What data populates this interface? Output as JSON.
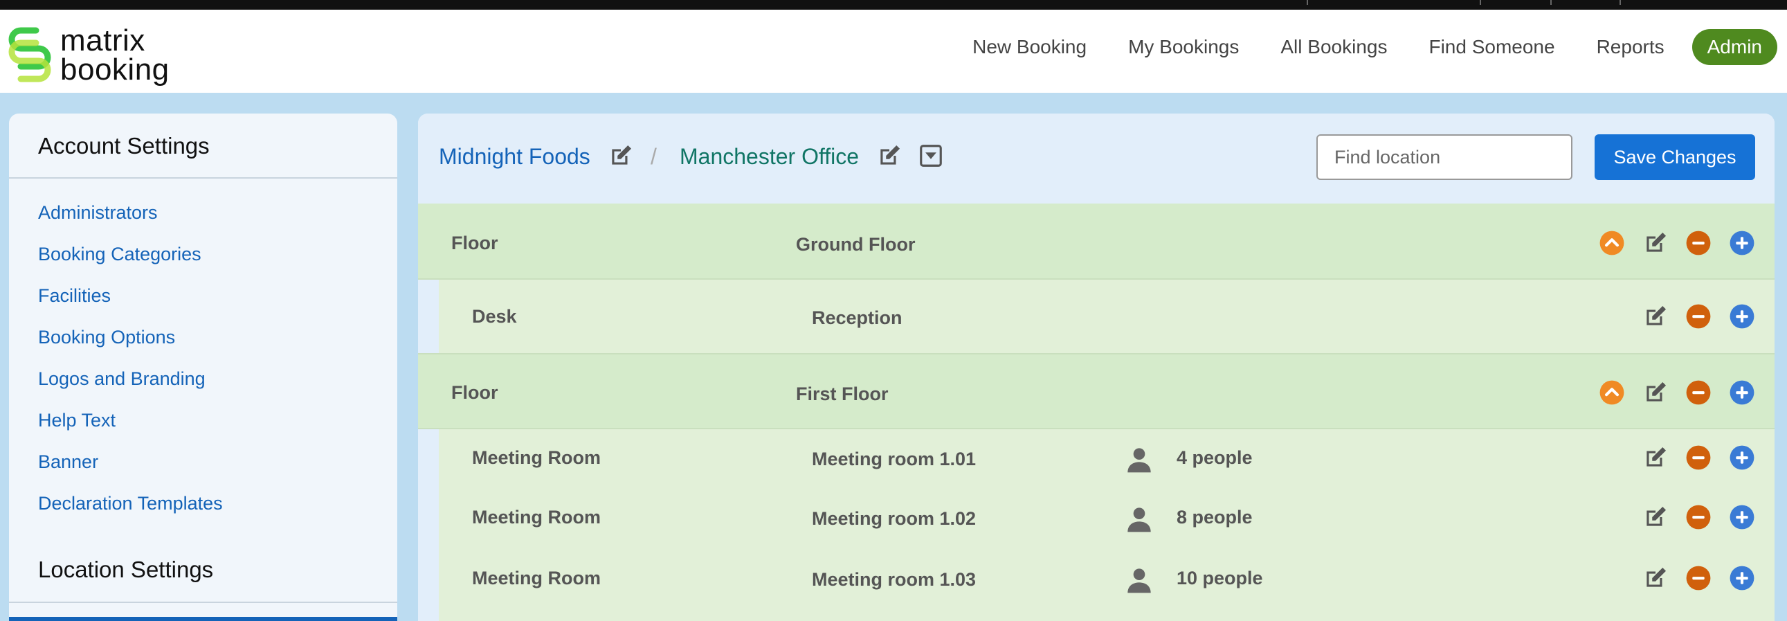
{
  "brand": {
    "line1": "matrix",
    "line2": "booking"
  },
  "nav": {
    "items": [
      "New Booking",
      "My Bookings",
      "All Bookings",
      "Find Someone",
      "Reports"
    ],
    "admin": "Admin"
  },
  "sidebar": {
    "account_heading": "Account Settings",
    "links": [
      "Administrators",
      "Booking Categories",
      "Facilities",
      "Booking Options",
      "Logos and Branding",
      "Help Text",
      "Banner",
      "Declaration Templates"
    ],
    "location_heading": "Location Settings"
  },
  "breadcrumb": {
    "org": "Midnight Foods",
    "separator": "/",
    "site": "Manchester Office"
  },
  "search": {
    "placeholder": "Find location"
  },
  "save_label": "Save Changes",
  "locations": [
    {
      "type": "Floor",
      "name": "Ground Floor",
      "capacity": "",
      "collapsible": true
    },
    {
      "type": "Desk",
      "name": "Reception",
      "capacity": "",
      "collapsible": false
    },
    {
      "type": "Floor",
      "name": "First Floor",
      "capacity": "",
      "collapsible": true
    },
    {
      "type": "Meeting Room",
      "name": "Meeting room 1.01",
      "capacity": "4 people",
      "collapsible": false
    },
    {
      "type": "Meeting Room",
      "name": "Meeting room 1.02",
      "capacity": "8 people",
      "collapsible": false
    },
    {
      "type": "Meeting Room",
      "name": "Meeting room 1.03",
      "capacity": "10 people",
      "collapsible": false
    }
  ],
  "colors": {
    "brand_green": "#4f8a1f",
    "link_blue": "#1463b8",
    "save_blue": "#1672d6",
    "collapse_orange": "#f08a24",
    "remove_orange": "#d0600c",
    "add_blue": "#3a7bd5"
  },
  "icons": [
    "edit-icon",
    "dropdown-icon",
    "collapse-icon",
    "remove-icon",
    "add-icon",
    "person-icon"
  ]
}
